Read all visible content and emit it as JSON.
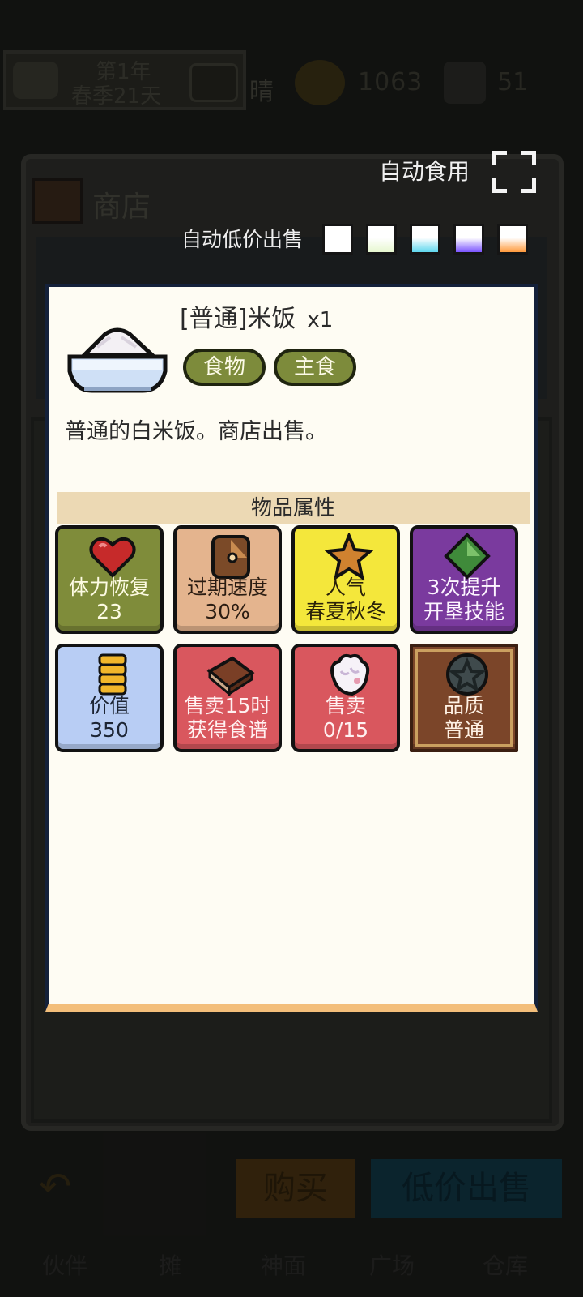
{
  "top_bar": {
    "year": "第1年",
    "season_day": "春季21天",
    "weather": "晴",
    "coins": "1063",
    "gems": "51"
  },
  "shop": {
    "title": "商店",
    "auto_eat_label": "自动食用",
    "auto_sell_label": "自动低价出售",
    "quality_swatches": [
      "#ffffff",
      "#e6f7cf",
      "#5fd7ee",
      "#7b55ff",
      "#ff9a3c"
    ]
  },
  "item": {
    "name": "[普通]米饭",
    "quantity": "x1",
    "tags": [
      "食物",
      "主食"
    ],
    "description": "普通的白米饭。商店出售。",
    "section_title": "物品属性"
  },
  "attributes": [
    {
      "icon": "heart-icon",
      "line1": "体力恢复",
      "line2": "23",
      "color": "#7f8c3a"
    },
    {
      "icon": "clock-icon",
      "line1": "过期速度",
      "line2": "30%",
      "color": "#e4b48e"
    },
    {
      "icon": "star-icon",
      "line1": "人气",
      "line2": "春夏秋冬",
      "color": "#f4e73b"
    },
    {
      "icon": "diamond-icon",
      "line1": "3次提升",
      "line2": "开垦技能",
      "color": "#7a3a9e"
    },
    {
      "icon": "coin-stack-icon",
      "line1": "价值",
      "line2": "350",
      "color": "#b8cdf4"
    },
    {
      "icon": "recipe-book-icon",
      "line1": "售卖15时",
      "line2": "获得食谱",
      "color": "#d9575e"
    },
    {
      "icon": "glove-icon",
      "line1": "售卖",
      "line2": "0/15",
      "color": "#d9575e"
    },
    {
      "icon": "quality-medal-icon",
      "line1": "品质",
      "line2": "普通",
      "color": "#7b4529"
    }
  ],
  "actions": {
    "buy": "购买",
    "sell_low": "低价出售"
  },
  "nav": [
    "伙伴",
    "摊",
    "神面",
    "广场",
    "仓库"
  ]
}
